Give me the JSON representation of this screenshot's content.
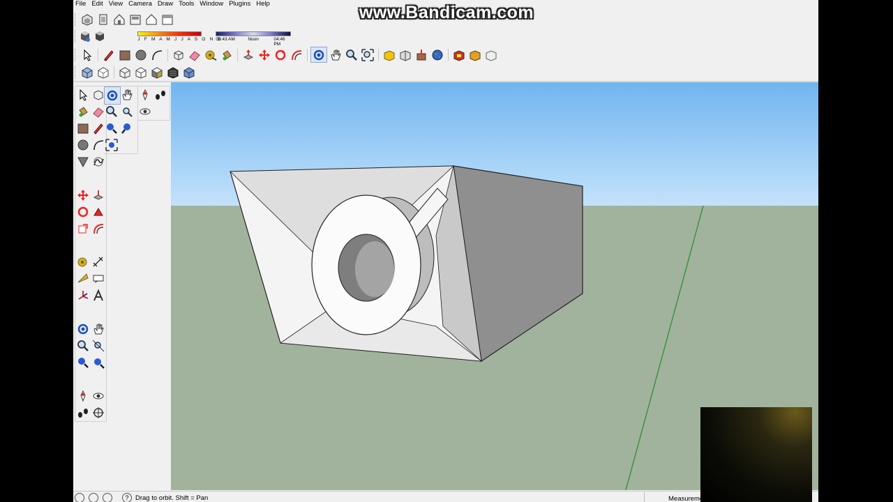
{
  "watermark": "www.Bandicam.com",
  "menu": [
    "File",
    "Edit",
    "View",
    "Camera",
    "Draw",
    "Tools",
    "Window",
    "Plugins",
    "Help"
  ],
  "shadow": {
    "months": "J F M A M J J A S O N D",
    "time_start": "06:43 AM",
    "time_noon": "Noon",
    "time_end": "04:46 PM"
  },
  "status": {
    "help_text": "Drag to orbit.  Shift = Pan",
    "measurements_label": "Measurements"
  },
  "colors": {
    "sky_top": "#70b5f0",
    "sky_bottom": "#c3e2fb",
    "ground": "#a1b39c",
    "axis_green": "#2f8f2f"
  }
}
